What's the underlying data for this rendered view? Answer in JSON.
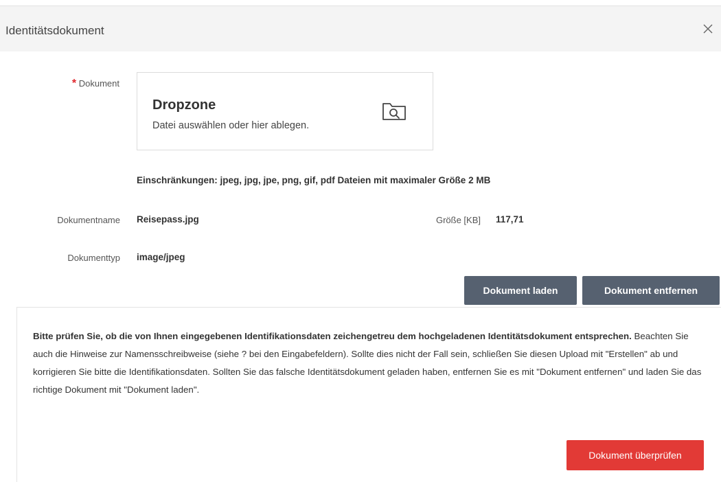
{
  "dialog": {
    "title": "Identitätsdokument",
    "close_icon": "close-icon"
  },
  "form": {
    "required_marker": "*",
    "document_label": "Dokument",
    "dropzone": {
      "title": "Dropzone",
      "subtitle": "Datei auswählen oder hier ablegen.",
      "icon": "folder-search-icon"
    },
    "restrictions": "Einschränkungen: jpeg, jpg, jpe, png, gif, pdf Dateien mit maximaler Größe 2 MB",
    "document_name_label": "Dokumentname",
    "document_name_value": "Reisepass.jpg",
    "size_label": "Größe [KB]",
    "size_value": "117,71",
    "document_type_label": "Dokumenttyp",
    "document_type_value": "image/jpeg"
  },
  "actions": {
    "load_label": "Dokument laden",
    "remove_label": "Dokument entfernen",
    "verify_label": "Dokument überprüfen"
  },
  "notice": {
    "bold_text": "Bitte prüfen Sie, ob die von Ihnen eingegebenen Identifikationsdaten zeichengetreu dem hochgeladenen Identitätsdokument entsprechen.",
    "body_text": " Beachten Sie auch die Hinweise zur Namensschreibweise (siehe ? bei den Eingabefeldern). Sollte dies nicht der Fall sein, schließen Sie diesen Upload mit \"Erstellen\" ab und korrigieren Sie bitte die Identifikationsdaten. Sollten Sie das falsche Identitätsdokument geladen haben, entfernen Sie es mit \"Dokument entfernen\" und laden Sie das richtige Dokument mit \"Dokument laden\"."
  },
  "colors": {
    "primary_button": "#566170",
    "danger_button": "#e23a36",
    "header_bg": "#f4f4f4",
    "required": "#e0262c"
  }
}
